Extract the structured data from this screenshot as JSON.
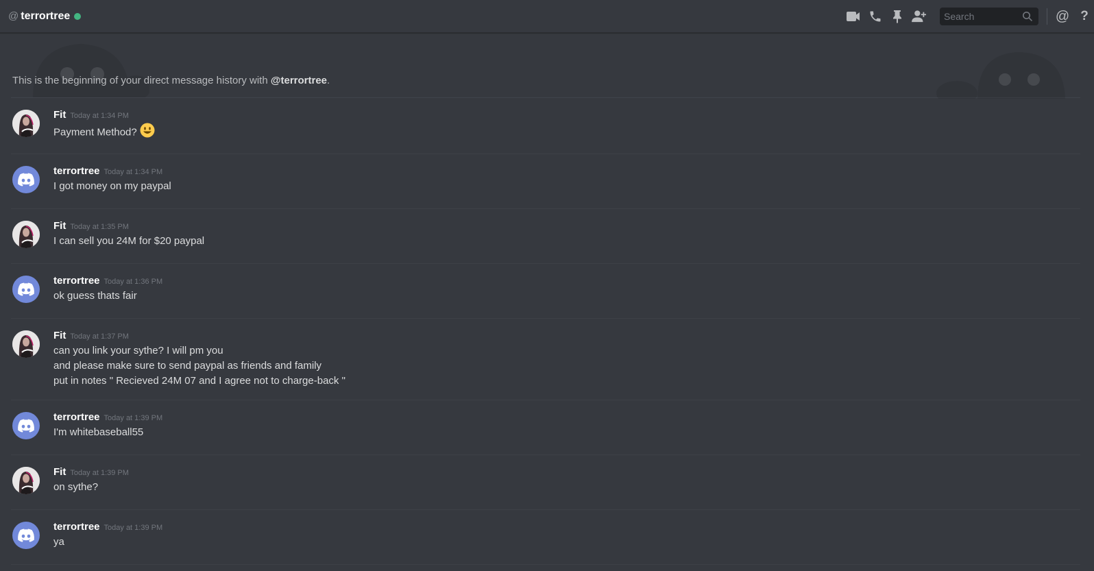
{
  "header": {
    "at": "@",
    "title": "terrortree",
    "status_color": "#43b581",
    "icons": [
      "video-icon",
      "phone-icon",
      "pin-icon",
      "add-friend-icon",
      "mention-icon",
      "help-icon"
    ],
    "search_placeholder": "Search",
    "mention_glyph": "@",
    "help_glyph": "?"
  },
  "beginning": {
    "prefix": "This is the beginning of your direct message history with ",
    "mention": "@terrortree",
    "suffix": "."
  },
  "colors": {
    "background": "#36393f",
    "blurple": "#7289da",
    "online": "#43b581"
  },
  "messages": [
    {
      "author": "Fit",
      "time": "Today at 1:34 PM",
      "lines": [
        "Payment Method?"
      ],
      "emoji": "smiley"
    },
    {
      "author": "terrortree",
      "time": "Today at 1:34 PM",
      "lines": [
        "I got money on my paypal"
      ]
    },
    {
      "author": "Fit",
      "time": "Today at 1:35 PM",
      "lines": [
        "I can sell you 24M for $20 paypal"
      ]
    },
    {
      "author": "terrortree",
      "time": "Today at 1:36 PM",
      "lines": [
        "ok guess thats fair"
      ]
    },
    {
      "author": "Fit",
      "time": "Today at 1:37 PM",
      "lines": [
        "can you link your sythe? I will pm you",
        "and please make sure to send paypal as friends and family",
        "put in notes \" Recieved 24M 07 and I agree not to charge-back \""
      ]
    },
    {
      "author": "terrortree",
      "time": "Today at 1:39 PM",
      "lines": [
        "I'm whitebaseball55"
      ]
    },
    {
      "author": "Fit",
      "time": "Today at 1:39 PM",
      "lines": [
        "on sythe?"
      ]
    },
    {
      "author": "terrortree",
      "time": "Today at 1:39 PM",
      "lines": [
        "ya"
      ]
    }
  ]
}
